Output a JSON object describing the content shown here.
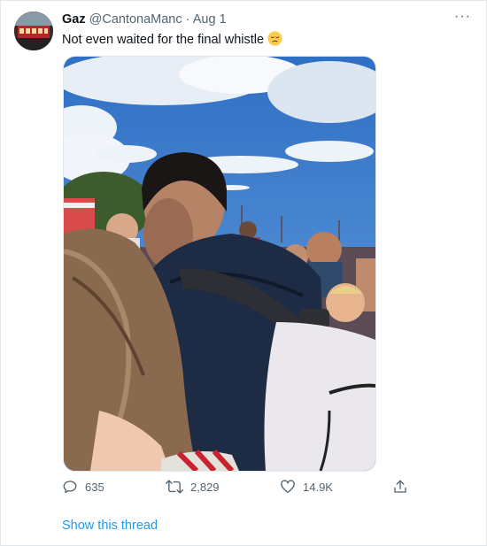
{
  "tweet": {
    "display_name": "Gaz",
    "handle": "@CantonaManc",
    "separator": "·",
    "date": "Aug 1",
    "text": "Not even waited for the final whistle",
    "emoji_icon": "pensive-face-emoji",
    "more_icon": "more-horizontal-icon",
    "more_label": "···"
  },
  "actions": {
    "reply": {
      "icon": "reply-icon",
      "count": "635"
    },
    "retweet": {
      "icon": "retweet-icon",
      "count": "2,829"
    },
    "like": {
      "icon": "heart-icon",
      "count": "14.9K"
    },
    "share": {
      "icon": "share-icon"
    }
  },
  "thread_link": "Show this thread",
  "colors": {
    "link": "#1d9bf0",
    "secondary_text": "#536471",
    "primary_text": "#0f1419",
    "border": "#e1e8ed"
  }
}
